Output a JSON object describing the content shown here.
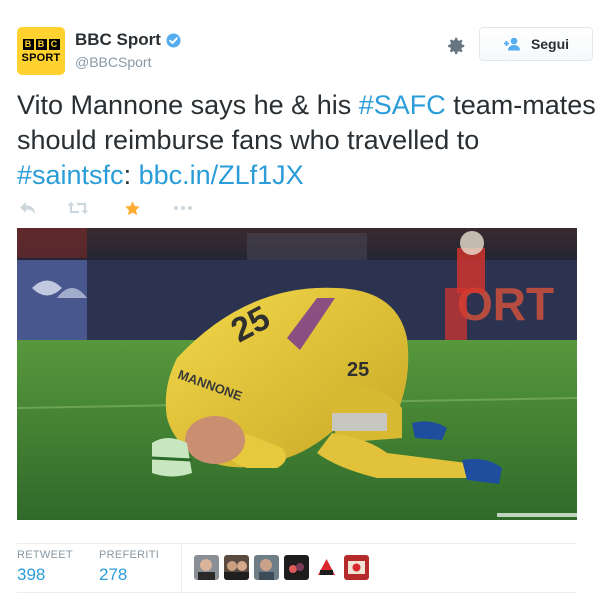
{
  "author": {
    "avatar_top": "BBC",
    "avatar_bottom": "SPORT",
    "name": "BBC Sport",
    "handle": "@BBCSport"
  },
  "follow_label": "Segui",
  "tweet": {
    "part1": "Vito Mannone says he & his ",
    "hashtag1": "#SAFC",
    "part2": " team-mates should reimburse fans who travelled to ",
    "hashtag2": "#saintsfc",
    "part3": ": ",
    "link": "bbc.in/ZLf1JX"
  },
  "photo": {
    "shirt_name": "MANNONE",
    "shirt_number": "25",
    "back_number": "25",
    "board_text": "ORT"
  },
  "stats": {
    "retweet_label": "RETWEET",
    "retweet_count": "398",
    "favorites_label": "PREFERITI",
    "favorites_count": "278"
  },
  "colors": {
    "link": "#2a9cd8",
    "favorite_star": "#ffac33",
    "avatar_bg": "#ffd230"
  },
  "icons": [
    "verified-icon",
    "gear-icon",
    "follow-person-icon",
    "reply-icon",
    "retweet-icon",
    "favorite-star-icon",
    "more-icon"
  ]
}
